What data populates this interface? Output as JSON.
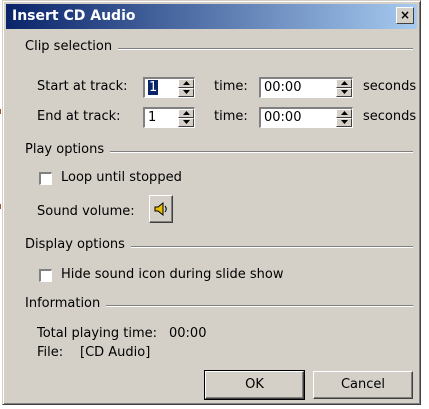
{
  "window": {
    "title": "Insert CD Audio",
    "close_glyph": "×"
  },
  "clip_selection": {
    "heading": "Clip selection",
    "start": {
      "label": "Start at track:",
      "track_value": "1",
      "time_label": "time:",
      "time_value": "00:00",
      "unit": "seconds"
    },
    "end": {
      "label": "End at track:",
      "track_value": "1",
      "time_label": "time:",
      "time_value": "00:00",
      "unit": "seconds"
    }
  },
  "play_options": {
    "heading": "Play options",
    "loop_label": "Loop until stopped",
    "loop_checked": false,
    "volume_label": "Sound volume:",
    "volume_icon": "speaker-icon"
  },
  "display_options": {
    "heading": "Display options",
    "hide_icon_label": "Hide sound icon during slide show",
    "hide_icon_checked": false
  },
  "information": {
    "heading": "Information",
    "total_label": "Total playing time:",
    "total_value": "00:00",
    "file_label": "File:",
    "file_value": "[CD Audio]"
  },
  "buttons": {
    "ok": "OK",
    "cancel": "Cancel"
  },
  "colors": {
    "titlebar_start": "#0a246a",
    "titlebar_end": "#a6caf0",
    "face": "#d4d0c8"
  }
}
